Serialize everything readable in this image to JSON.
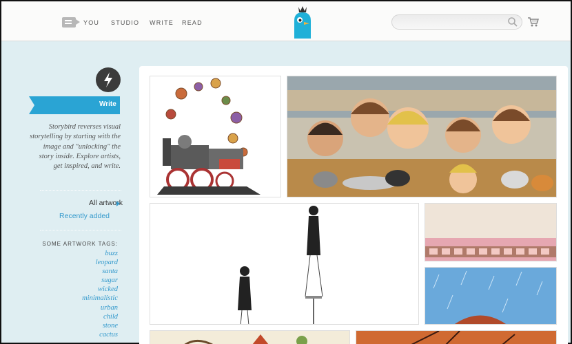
{
  "nav": {
    "items": [
      {
        "label": "YOU"
      },
      {
        "label": "STUDIO"
      },
      {
        "label": "WRITE"
      },
      {
        "label": "READ"
      }
    ],
    "search": {
      "value": "",
      "placeholder": ""
    },
    "icons": {
      "menu": "menu-icon",
      "logo": "storybird-logo",
      "search": "search-icon",
      "cart": "cart-icon"
    }
  },
  "sidebar": {
    "section_label": "Write",
    "intro": "Storybird reverses visual storytelling by starting with the image and \"unlocking\" the story inside. Explore artists, get inspired, and write.",
    "filters": {
      "all": "All artwork",
      "recent": "Recently added"
    },
    "tags_heading": "SOME ARTWORK TAGS:",
    "tags": [
      "buzz",
      "leopard",
      "santa",
      "sugar",
      "wicked",
      "minimalistic",
      "urban",
      "child",
      "stone",
      "cactus"
    ]
  },
  "gallery": {
    "tiles": [
      {
        "name": "artwork-steam-train"
      },
      {
        "name": "artwork-kids-and-cats"
      },
      {
        "name": "artwork-lady-on-stilts"
      },
      {
        "name": "artwork-pink-sky-film"
      },
      {
        "name": "artwork-blue-rain"
      },
      {
        "name": "artwork-tree-houses"
      },
      {
        "name": "artwork-autumn-tree"
      }
    ]
  },
  "colors": {
    "accent": "#3399cc",
    "ribbon": "#2aa4d4",
    "logo": "#1fb0d8",
    "background": "#dfeef2"
  }
}
